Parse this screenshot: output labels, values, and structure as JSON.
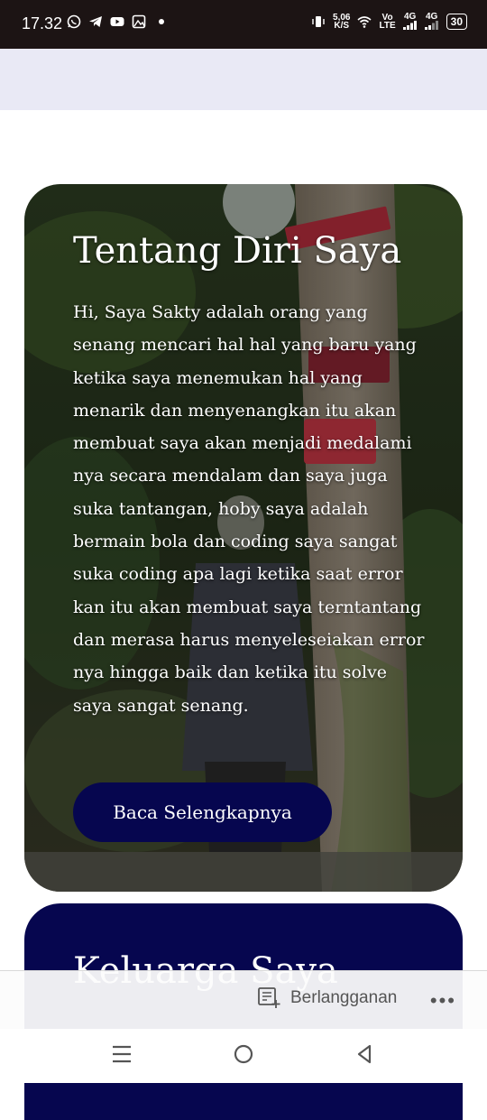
{
  "status_bar": {
    "time": "17.32",
    "speed_value": "5,06",
    "speed_unit": "K/S",
    "volte_top": "Vo",
    "volte_bottom": "LTE",
    "signal1_label": "4G",
    "signal2_label": "4G",
    "battery": "30"
  },
  "about": {
    "title": "Tentang Diri Saya",
    "body": "Hi, Saya Sakty adalah orang yang senang mencari hal hal yang baru yang ketika saya menemukan hal yang menarik dan menyenangkan itu akan membuat saya akan menjadi medalami nya secara mendalam dan saya juga suka tantangan, hoby saya adalah bermain bola dan coding saya sangat suka coding apa lagi ketika saat error kan itu akan membuat saya terntantang dan merasa harus menyeleseiakan error nya hingga baik dan ketika itu solve saya sangat senang.",
    "button_label": "Baca Selengkapnya"
  },
  "family": {
    "title": "Keluarga Saya"
  },
  "subscribe_bar": {
    "subscribe_label": "Berlangganan",
    "more_label": "•••"
  },
  "colors": {
    "accent": "#06064f",
    "status_bar": "#1c1414"
  },
  "icons": [
    "whatsapp-icon",
    "telegram-icon",
    "youtube-icon",
    "gallery-icon",
    "vibrate-icon",
    "wifi-icon",
    "signal-icon",
    "battery-icon",
    "subscribe-icon",
    "menu-icon",
    "home-icon",
    "back-icon"
  ]
}
